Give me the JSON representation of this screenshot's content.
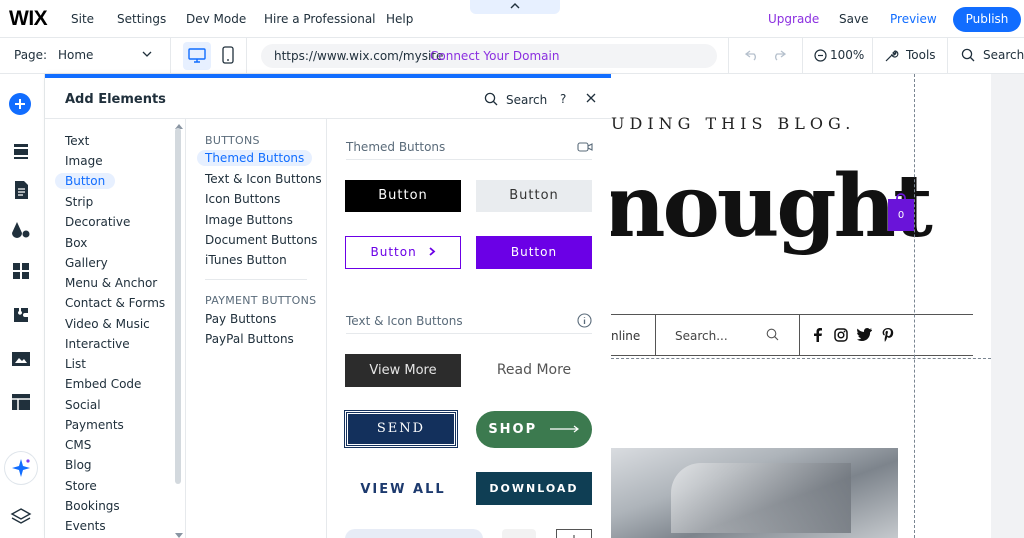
{
  "topbar": {
    "logo": "WIX",
    "menu": [
      "Site",
      "Settings",
      "Dev Mode",
      "Hire a Professional",
      "Help"
    ],
    "upgrade": "Upgrade",
    "save": "Save",
    "preview": "Preview",
    "publish": "Publish"
  },
  "toolbar": {
    "page_label": "Page:",
    "page_value": "Home",
    "url": "https://www.wix.com/mysite",
    "connect_domain": "Connect Your Domain",
    "zoom": "100%",
    "tools": "Tools",
    "search": "Search"
  },
  "panel": {
    "title": "Add Elements",
    "search": "Search",
    "help": "?",
    "categories": [
      "Text",
      "Image",
      "Button",
      "Strip",
      "Decorative",
      "Box",
      "Gallery",
      "Menu & Anchor",
      "Contact & Forms",
      "Video & Music",
      "Interactive",
      "List",
      "Embed Code",
      "Social",
      "Payments",
      "CMS",
      "Blog",
      "Store",
      "Bookings",
      "Events"
    ],
    "active_category": "Button",
    "sub_heading_1": "BUTTONS",
    "sub_items_1": [
      "Themed Buttons",
      "Text & Icon Buttons",
      "Icon Buttons",
      "Image Buttons",
      "Document Buttons",
      "iTunes Button"
    ],
    "sub_heading_2": "PAYMENT BUTTONS",
    "sub_items_2": [
      "Pay Buttons",
      "PayPal Buttons"
    ],
    "section_1_title": "Themed Buttons",
    "section_2_title": "Text & Icon Buttons",
    "themed_buttons": [
      "Button",
      "Button",
      "Button",
      "Button"
    ],
    "text_icon_buttons": [
      "View More",
      "Read More",
      "SEND",
      "SHOP",
      "VIEW ALL",
      "DOWNLOAD"
    ],
    "accent_color": "#116dff",
    "purple_color": "#6b00e6"
  },
  "canvas": {
    "tagline": "UDING THIS BLOG.",
    "headline": "nought",
    "cart_count": "0",
    "nav_fragment": "nline",
    "search_placeholder": "Search..."
  }
}
